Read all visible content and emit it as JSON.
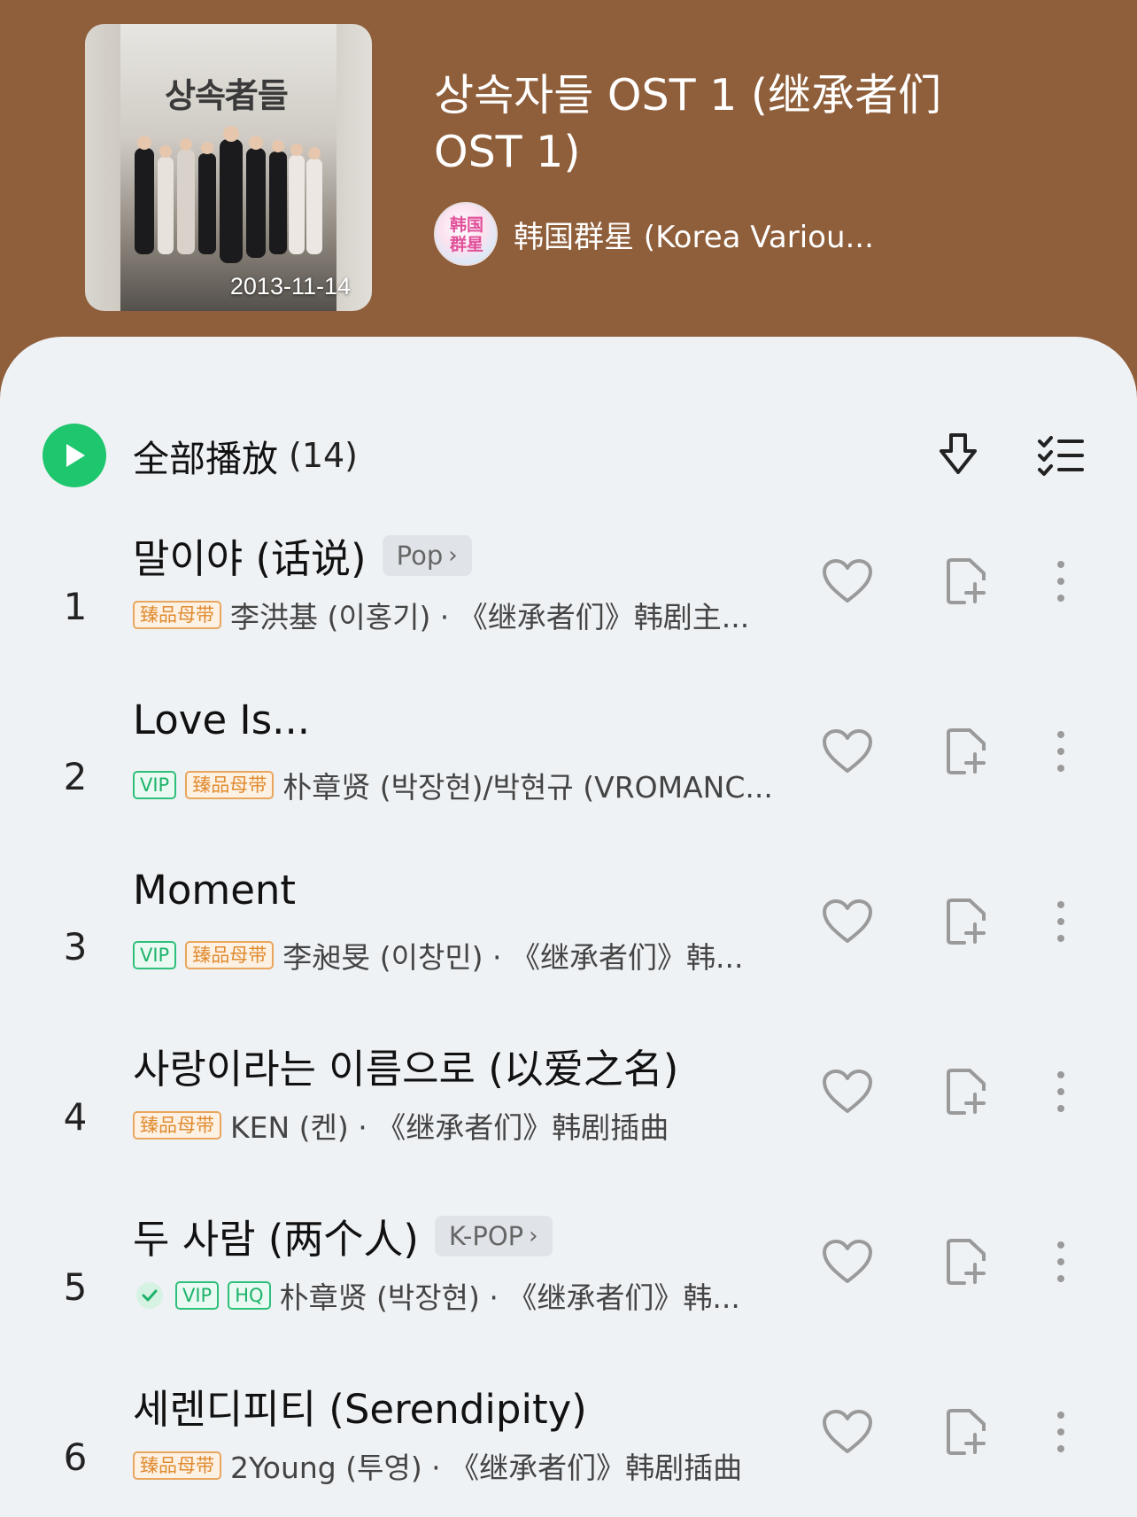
{
  "album": {
    "cover_title": "상속者들",
    "date": "2013-11-14",
    "title": "상속자들 OST 1 (继承者们 OST 1)",
    "artist_avatar_text": "韩国群星",
    "artist": "韩国群星 (Korea Variou..."
  },
  "toolbar": {
    "play_all_label": "全部播放",
    "track_count": "(14)"
  },
  "tracks": [
    {
      "num": "1",
      "title": "말이야 (话说)",
      "genre": "Pop",
      "badges": [
        "臻品母带"
      ],
      "meta": "李洪基 (이홍기) · 《继承者们》韩剧主..."
    },
    {
      "num": "2",
      "title": "Love Is...",
      "genre": "",
      "badges": [
        "VIP",
        "臻品母带"
      ],
      "meta": "朴章贤 (박장현)/박현규 (VROMANC..."
    },
    {
      "num": "3",
      "title": "Moment",
      "genre": "",
      "badges": [
        "VIP",
        "臻品母带"
      ],
      "meta": "李昶旻 (이창민) · 《继承者们》韩..."
    },
    {
      "num": "4",
      "title": "사랑이라는 이름으로 (以爱之名)",
      "genre": "",
      "badges": [
        "臻品母带"
      ],
      "meta": "KEN (켄) · 《继承者们》韩剧插曲"
    },
    {
      "num": "5",
      "title": "두 사람 (两个人)",
      "genre": "K-POP",
      "badges": [
        "VIP",
        "HQ"
      ],
      "meta": "朴章贤 (박장현) · 《继承者们》韩..."
    },
    {
      "num": "6",
      "title": "세렌디피티 (Serendipity)",
      "genre": "",
      "badges": [
        "臻品母带"
      ],
      "meta": "2Young (투영) · 《继承者们》韩剧插曲"
    }
  ],
  "colors": {
    "header_bg": "#8f5e3a",
    "accent_green": "#1ec66e",
    "sheet_bg": "#eff2f5",
    "master_badge": "#e08a2e"
  }
}
